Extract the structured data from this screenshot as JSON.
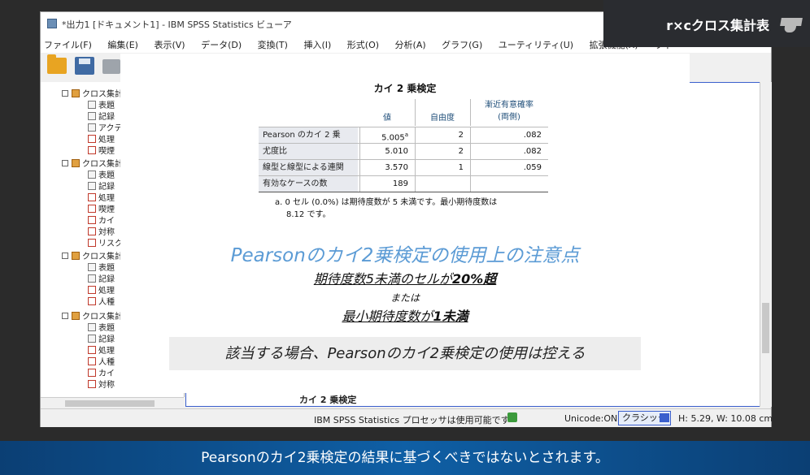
{
  "window": {
    "title": "*出力1 [ドキュメント1] - IBM SPSS Statistics ビューア",
    "menu": [
      "ファイル(F)",
      "編集(E)",
      "表示(V)",
      "データ(D)",
      "変換(T)",
      "挿入(I)",
      "形式(O)",
      "分析(A)",
      "グラフ(G)",
      "ユーティリティ(U)",
      "拡張機能(X)",
      "ウィ"
    ]
  },
  "tree": {
    "items": [
      "クロス集計",
      "表題",
      "記録",
      "アクティブ",
      "処理",
      "喫煙",
      "クロス集計",
      "表題",
      "記録",
      "処理",
      "喫煙",
      "カイ",
      "対称",
      "リスク",
      "クロス集計",
      "表題",
      "記録",
      "処理",
      "人種",
      "クロス集計",
      "表題",
      "記録",
      "処理",
      "人種",
      "カイ",
      "対称"
    ]
  },
  "viewer": {
    "below_caption": "カイ 2 乗検定"
  },
  "status": {
    "processor": "IBM SPSS Statistics プロセッサは使用可能です",
    "unicode": "Unicode:ON",
    "mode": "クラシック",
    "size": "H: 5.29, W: 10.08 cm"
  },
  "chapter": {
    "label": "r×cクロス集計表"
  },
  "slide": {
    "table": {
      "title": "カイ 2 乗検定",
      "headers": {
        "value": "値",
        "df": "自由度",
        "sig_l1": "漸近有意確率",
        "sig_l2": "(両側)"
      },
      "rows": [
        {
          "label": "Pearson のカイ 2 乗",
          "value": "5.005",
          "sup": "a",
          "df": "2",
          "sig": ".082"
        },
        {
          "label": "尤度比",
          "value": "5.010",
          "sup": "",
          "df": "2",
          "sig": ".082"
        },
        {
          "label": "線型と線型による連関",
          "value": "3.570",
          "sup": "",
          "df": "1",
          "sig": ".059"
        },
        {
          "label": "有効なケースの数",
          "value": "189",
          "sup": "",
          "df": "",
          "sig": ""
        }
      ],
      "footnote_l1": "a. 0 セル (0.0%) は期待度数が 5 未満です。最小期待度数は",
      "footnote_l2": "8.12 です。"
    },
    "notice_title": "Pearsonのカイ2乗検定の使用上の注意点",
    "condition1_pre": "期待度数5未満のセルが",
    "condition1_key": "20%超",
    "or": "または",
    "condition2_pre": "最小期待度数が",
    "condition2_key": "1未満",
    "advice": "該当する場合、Pearsonのカイ2乗検定の使用は控える"
  },
  "subtitle": "Pearsonのカイ2乗検定の結果に基づくべきではないとされます。"
}
